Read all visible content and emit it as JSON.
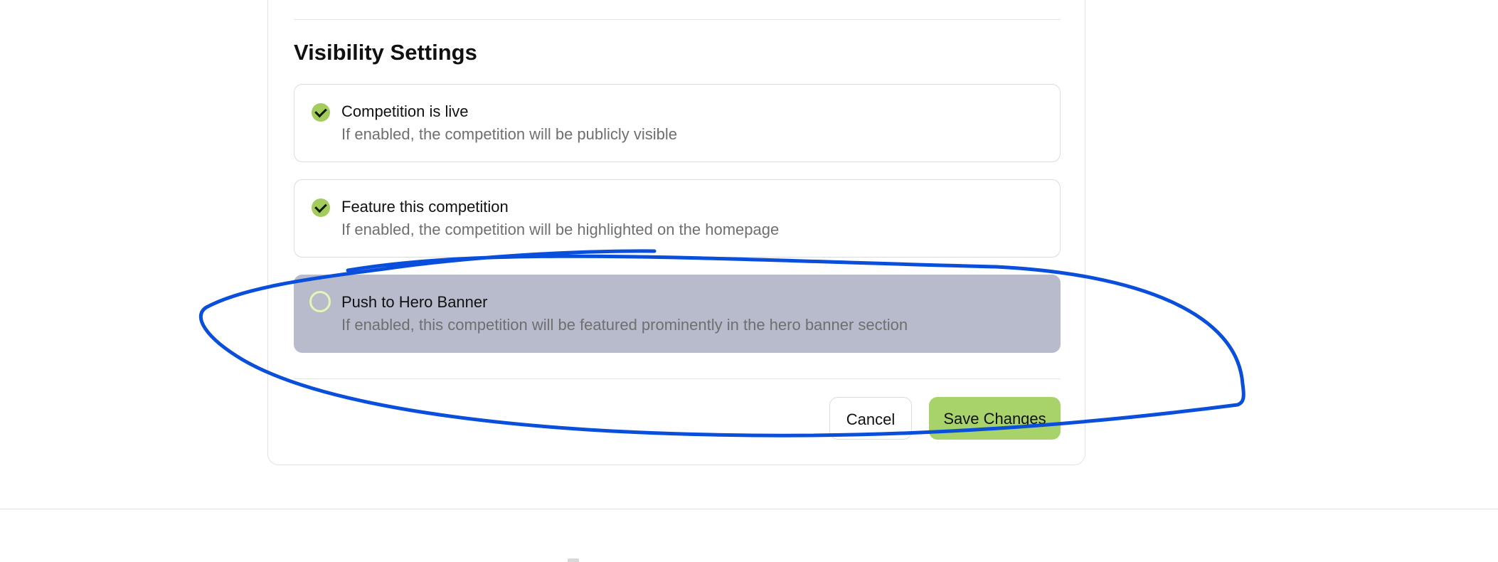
{
  "section": {
    "title": "Visibility Settings"
  },
  "options": [
    {
      "title": "Competition is live",
      "description": "If enabled, the competition will be publicly visible",
      "checked": true
    },
    {
      "title": "Feature this competition",
      "description": "If enabled, the competition will be highlighted on the homepage",
      "checked": true
    },
    {
      "title": "Push to Hero Banner",
      "description": "If enabled, this competition will be featured prominently in the hero banner section",
      "checked": false
    }
  ],
  "actions": {
    "cancel_label": "Cancel",
    "save_label": "Save Changes"
  },
  "colors": {
    "accent": "#a8d26a",
    "check_on": "#a4cc5c",
    "highlight_bg": "#b8bbcb",
    "annotation_stroke": "#0a4fdc"
  },
  "icons": {
    "checked": "check-circle-icon",
    "unchecked": "empty-circle-icon"
  }
}
